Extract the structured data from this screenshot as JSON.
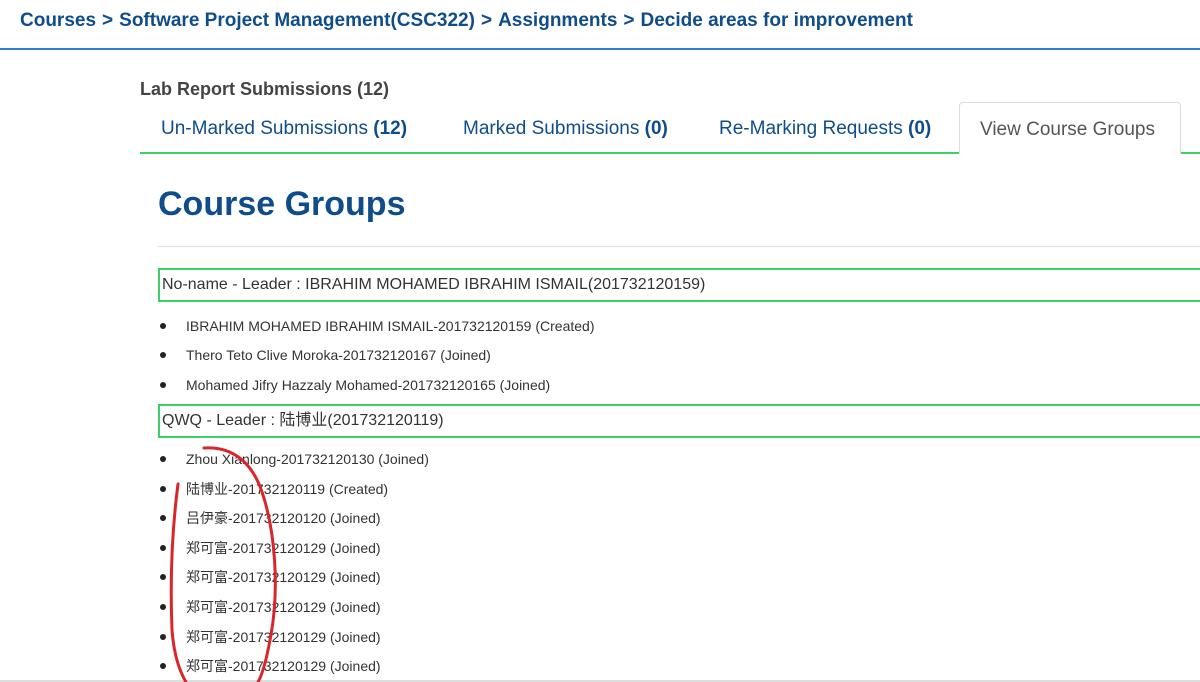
{
  "breadcrumb": {
    "items": [
      "Courses",
      "Software Project Management(CSC322)",
      "Assignments",
      "Decide areas for improvement"
    ],
    "separator": ">"
  },
  "section_title": "Lab Report Submissions (12)",
  "tabs": [
    {
      "label": "Un-Marked Submissions ",
      "count": "(12)"
    },
    {
      "label": "Marked Submissions ",
      "count": "(0)"
    },
    {
      "label": "Re-Marking Requests ",
      "count": "(0)"
    },
    {
      "label": "View Course Groups",
      "count": ""
    }
  ],
  "active_tab": "View Course Groups",
  "heading": "Course Groups",
  "groups": [
    {
      "title": "No-name - Leader : IBRAHIM MOHAMED IBRAHIM ISMAIL(201732120159)",
      "members": [
        "IBRAHIM MOHAMED IBRAHIM ISMAIL-201732120159 (Created)",
        "Thero Teto Clive Moroka-201732120167 (Joined)",
        "Mohamed Jifry Hazzaly Mohamed-201732120165 (Joined)"
      ]
    },
    {
      "title": "QWQ - Leader : 陆博业(201732120119)",
      "members": [
        "Zhou Xianlong-201732120130 (Joined)",
        "陆博业-201732120119 (Created)",
        "吕伊豪-201732120120 (Joined)",
        "郑可富-201732120129 (Joined)",
        "郑可富-201732120129 (Joined)",
        "郑可富-201732120129 (Joined)",
        "郑可富-201732120129 (Joined)",
        "郑可富-201732120129 (Joined)"
      ]
    }
  ],
  "colors": {
    "brand_blue": "#0f4d8a",
    "topbar_border": "#2e7bcf",
    "accent_green": "#3ad06a",
    "annotation_red": "#d9262a"
  }
}
